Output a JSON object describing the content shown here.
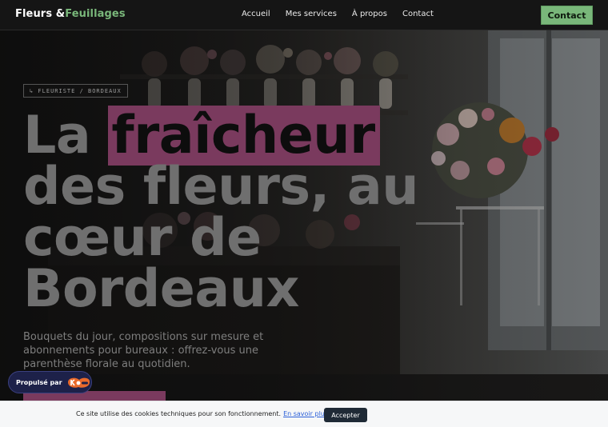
{
  "navbar": {
    "logo_main": "Fleurs &",
    "logo_accent": "Feuillages",
    "links": [
      "Accueil",
      "Mes services",
      "À propos",
      "Contact"
    ],
    "cta_label": "Contact",
    "accent_color": "#79b77a"
  },
  "hero": {
    "tag": "↳ FLEURISTE / BORDEAUX",
    "headline_before": "La ",
    "headline_highlight": "fraîcheur",
    "headline_after": " des fleurs, au cœur de Bordeaux",
    "subtitle": "Bouquets du jour, compositions sur mesure et abonnements pour bureaux : offrez-vous une parenthèse florale au quotidien.",
    "highlight_color": "#7a3a5e",
    "background": "flower-shop-photo"
  },
  "powered_by": {
    "label": "Propulsé par",
    "logo_icon": "kofee-logo-icon"
  },
  "cookie_bar": {
    "text": "Ce site utilise des cookies techniques pour son fonctionnement.",
    "link": "En savoir plus",
    "accept_label": "Accepter"
  }
}
